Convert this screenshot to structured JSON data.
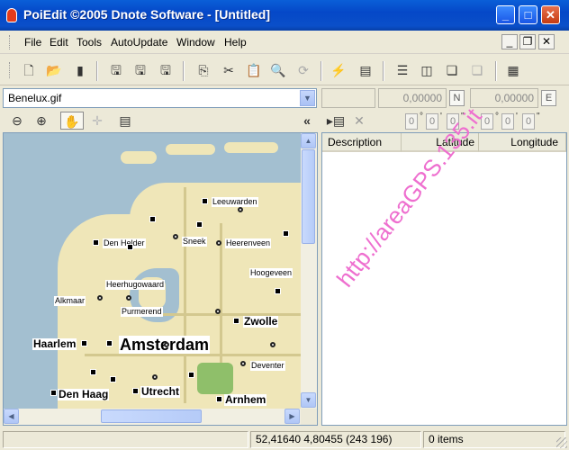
{
  "window": {
    "title": "PoiEdit ©2005 Dnote Software - [Untitled]"
  },
  "menu": {
    "items": [
      "File",
      "Edit",
      "Tools",
      "AutoUpdate",
      "Window",
      "Help"
    ]
  },
  "file_selector": {
    "value": "Benelux.gif"
  },
  "coords": {
    "lat_value": "0,00000",
    "lat_hemi": "N",
    "lon_value": "0,00000",
    "lon_hemi": "E",
    "lat_dms": [
      "0",
      "0",
      "0"
    ],
    "lon_dms": [
      "0",
      "0",
      "0"
    ]
  },
  "list": {
    "columns": [
      "Description",
      "Latitude",
      "Longitude"
    ]
  },
  "map": {
    "cities": [
      "Leeuwarden",
      "Den Helder",
      "Sneek",
      "Heerenveen",
      "Hoogeveen",
      "Heerhugowaard",
      "Alkmaar",
      "Purmerend",
      "Zwolle",
      "Haarlem",
      "Amsterdam",
      "Deventer",
      "Den Haag",
      "Utrecht",
      "Arnhem"
    ],
    "watermark": "http://areaGPS.135.it"
  },
  "status": {
    "coords": "52,41640 4,80455 (243 196)",
    "items": "0 items"
  }
}
